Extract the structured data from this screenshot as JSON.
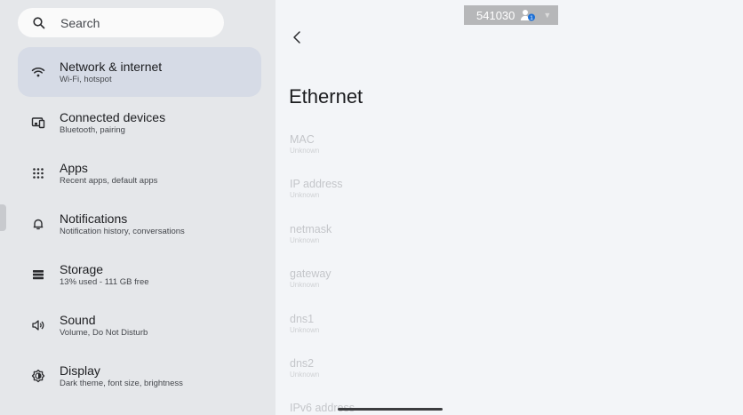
{
  "search": {
    "placeholder": "Search"
  },
  "sidebar": {
    "items": [
      {
        "label": "Network & internet",
        "sub": "Wi-Fi, hotspot",
        "icon": "wifi-icon"
      },
      {
        "label": "Connected devices",
        "sub": "Bluetooth, pairing",
        "icon": "connected-devices-icon"
      },
      {
        "label": "Apps",
        "sub": "Recent apps, default apps",
        "icon": "apps-grid-icon"
      },
      {
        "label": "Notifications",
        "sub": "Notification history, conversations",
        "icon": "bell-icon"
      },
      {
        "label": "Storage",
        "sub": "13% used - 111 GB free",
        "icon": "storage-icon"
      },
      {
        "label": "Sound",
        "sub": "Volume, Do Not Disturb",
        "icon": "speaker-icon"
      },
      {
        "label": "Display",
        "sub": "Dark theme, font size, brightness",
        "icon": "display-brightness-icon"
      }
    ]
  },
  "status": {
    "code": "541030",
    "badge": "1"
  },
  "detail": {
    "title": "Ethernet",
    "fields": [
      {
        "name": "MAC",
        "value": "Unknown"
      },
      {
        "name": "IP address",
        "value": "Unknown"
      },
      {
        "name": "netmask",
        "value": "Unknown"
      },
      {
        "name": "gateway",
        "value": "Unknown"
      },
      {
        "name": "dns1",
        "value": "Unknown"
      },
      {
        "name": "dns2",
        "value": "Unknown"
      },
      {
        "name": "IPv6 address",
        "value": ""
      }
    ]
  },
  "colors": {
    "selected": "#d6dbe6",
    "sidebar_bg": "#e5e7ea",
    "content_bg": "#f3f5f8"
  }
}
